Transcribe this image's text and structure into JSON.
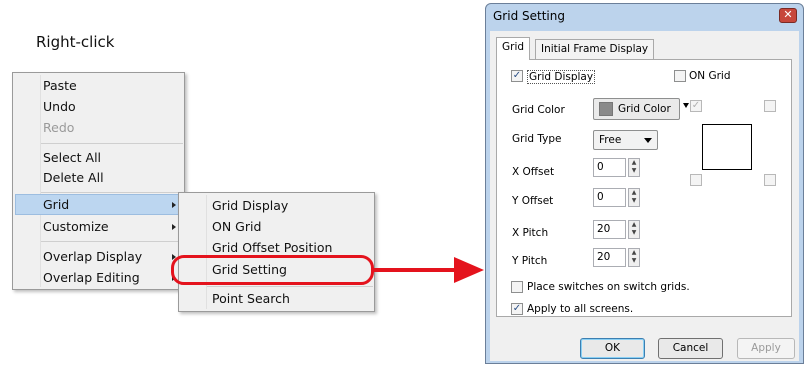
{
  "caption": "Right-click",
  "context_menu": {
    "items": [
      {
        "label": "Paste",
        "enabled": true
      },
      {
        "label": "Undo",
        "enabled": true
      },
      {
        "label": "Redo",
        "enabled": false
      },
      {
        "label": "Select All",
        "enabled": true
      },
      {
        "label": "Delete All",
        "enabled": true
      },
      {
        "label": "Grid",
        "enabled": true,
        "submenu": true,
        "highlighted": true
      },
      {
        "label": "Customize",
        "enabled": true,
        "submenu": true
      },
      {
        "label": "Overlap Display",
        "enabled": true,
        "submenu": true
      },
      {
        "label": "Overlap Editing",
        "enabled": true,
        "submenu": true
      }
    ]
  },
  "grid_submenu": {
    "items": [
      {
        "label": "Grid Display"
      },
      {
        "label": "ON Grid"
      },
      {
        "label": "Grid Offset Position"
      },
      {
        "label": "Grid Setting",
        "circled": true
      },
      {
        "label": "Point Search"
      }
    ]
  },
  "dialog": {
    "title": "Grid Setting",
    "close_glyph": "✕",
    "tabs": [
      "Grid",
      "Initial Frame Display"
    ],
    "active_tab": "Grid",
    "grid_display": {
      "label": "Grid Display",
      "checked": true
    },
    "on_grid": {
      "label": "ON Grid",
      "checked": false
    },
    "grid_color": {
      "label": "Grid Color",
      "button_label": "Grid Color",
      "swatch": "#8a8a8a"
    },
    "grid_type": {
      "label": "Grid Type",
      "value": "Free"
    },
    "x_offset": {
      "label": "X Offset",
      "value": "0"
    },
    "y_offset": {
      "label": "Y Offset",
      "value": "0"
    },
    "x_pitch": {
      "label": "X Pitch",
      "value": "20"
    },
    "y_pitch": {
      "label": "Y Pitch",
      "value": "20"
    },
    "place_switches": {
      "label": "Place switches on switch grids.",
      "checked": false
    },
    "apply_all": {
      "label": "Apply to all screens.",
      "checked": true
    },
    "buttons": {
      "ok": "OK",
      "cancel": "Cancel",
      "apply": "Apply"
    },
    "check_glyph": "✓"
  },
  "colors": {
    "highlight_ring": "#e4131d",
    "arrow": "#e4131d",
    "dialog_frame": "#bcd3ec"
  }
}
